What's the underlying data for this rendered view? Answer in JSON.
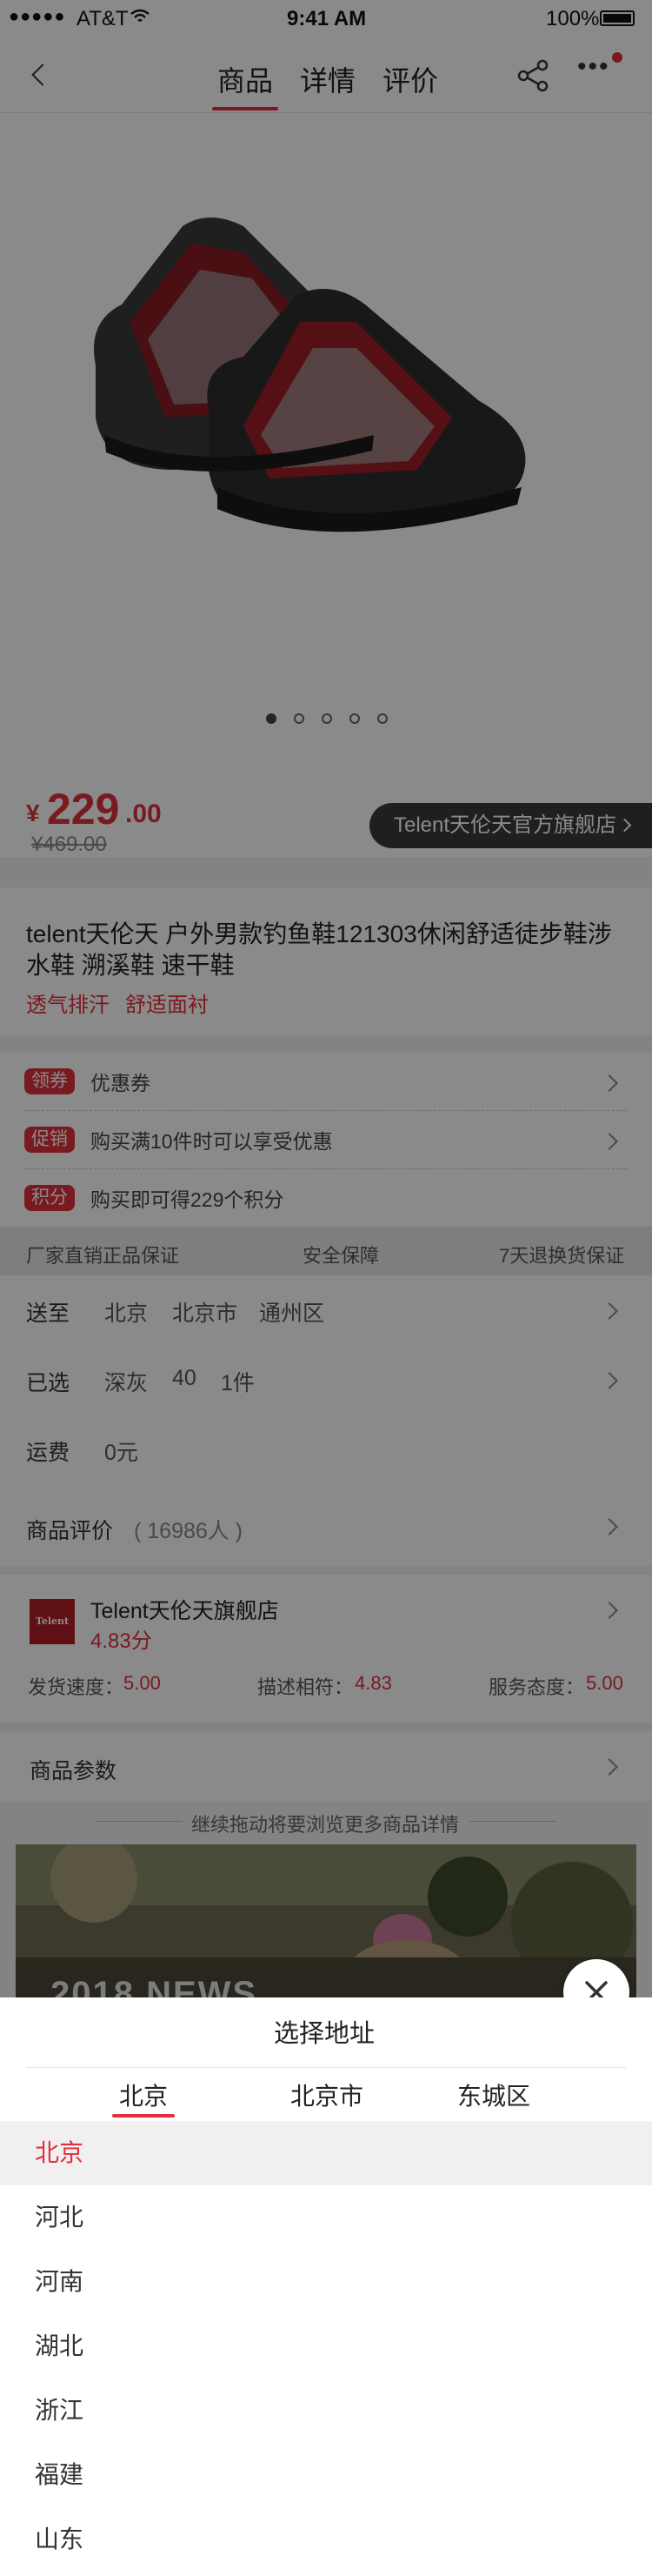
{
  "status_bar": {
    "carrier": "AT&T",
    "time": "9:41 AM",
    "battery": "100%"
  },
  "nav": {
    "tabs": [
      "商品",
      "详情",
      "评价"
    ],
    "active_tab": "商品"
  },
  "gallery": {
    "image_label": "户外溯溪鞋",
    "dots": 5,
    "active_dot": 0
  },
  "price": {
    "currency": "¥",
    "current_int": "229",
    "current_dec": ".00",
    "original": "¥469.00",
    "shop_badge": "Telent天伦天官方旗舰店"
  },
  "product": {
    "title": "telent天伦天 户外男款钓鱼鞋121303休闲舒适徒步鞋涉水鞋 溯溪鞋 速干鞋",
    "features": [
      "透气排汗",
      "舒适面衬"
    ]
  },
  "promotions": [
    {
      "tag": "领券",
      "text": "优惠券"
    },
    {
      "tag": "促销",
      "text": "购买满10件时可以享受优惠"
    },
    {
      "tag": "积分",
      "text": "购买即可得229个积分"
    }
  ],
  "guarantees": [
    "厂家直销正品保证",
    "安全保障",
    "7天退换货保证"
  ],
  "shipping": {
    "deliver_label": "送至",
    "deliver": [
      "北京",
      "北京市",
      "通州区"
    ],
    "selected_label": "已选",
    "selected": [
      "深灰",
      "40",
      "1件"
    ],
    "freight_label": "运费",
    "freight": "0元"
  },
  "reviews": {
    "label": "商品评价",
    "count": "( 16986人 )"
  },
  "store": {
    "logo": "Telent",
    "name": "Telent天伦天旗舰店",
    "score": "4.83分",
    "ship_label": "发货速度：",
    "ship_value": "5.00",
    "desc_label": "描述相符：",
    "desc_value": "4.83",
    "service_label": "服务态度：",
    "service_value": "5.00"
  },
  "params": {
    "label": "商品参数"
  },
  "drag_hint": "继续拖动将要浏览更多商品详情",
  "promo_image": {
    "overlay_text": "2018 NEWS"
  },
  "address_sheet": {
    "title": "选择地址",
    "tabs": [
      "北京",
      "北京市",
      "东城区"
    ],
    "regions": [
      "北京",
      "河北",
      "河南",
      "湖北",
      "浙江",
      "福建",
      "山东"
    ],
    "selected_region": "北京"
  },
  "colors": {
    "accent": "#e0313d",
    "overlay": "rgba(0,0,0,0.46)"
  }
}
